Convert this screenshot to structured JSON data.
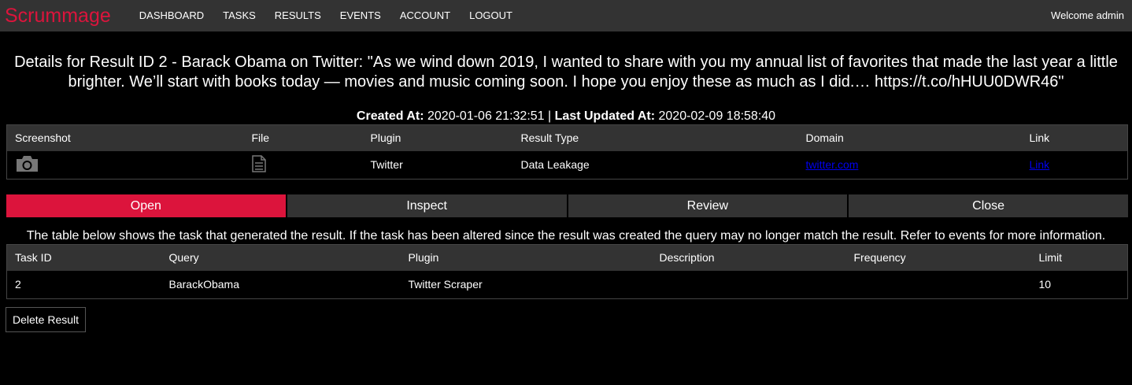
{
  "navbar": {
    "brand": "Scrummage",
    "items": [
      "DASHBOARD",
      "TASKS",
      "RESULTS",
      "EVENTS",
      "ACCOUNT",
      "LOGOUT"
    ],
    "welcome": "Welcome admin"
  },
  "title": "Details for Result ID 2 - Barack Obama on Twitter: \"As we wind down 2019, I wanted to share with you my annual list of favorites that made the last year a little brighter. We’ll start with books today — movies and music coming soon. I hope you enjoy these as much as I did.… https://t.co/hHUU0DWR46\"",
  "timestamps": {
    "created_label": "Created At:",
    "created_value": "2020-01-06 21:32:51",
    "separator": "|",
    "updated_label": "Last Updated At:",
    "updated_value": "2020-02-09 18:58:40"
  },
  "result_table": {
    "headers": [
      "Screenshot",
      "File",
      "Plugin",
      "Result Type",
      "Domain",
      "Link"
    ],
    "row": {
      "screenshot_icon": "camera-icon",
      "file_icon": "file-icon",
      "plugin": "Twitter",
      "result_type": "Data Leakage",
      "domain": "twitter.com",
      "link": "Link"
    }
  },
  "status_buttons": [
    "Open",
    "Inspect",
    "Review",
    "Close"
  ],
  "active_status": "Open",
  "accent_color": "#dc143c",
  "note": "The table below shows the task that generated the result. If the task has been altered since the result was created the query may no longer match the result. Refer to events for more information.",
  "task_table": {
    "headers": [
      "Task ID",
      "Query",
      "Plugin",
      "Description",
      "Frequency",
      "Limit"
    ],
    "row": {
      "task_id": "2",
      "query": "BarackObama",
      "plugin": "Twitter Scraper",
      "description": "",
      "frequency": "",
      "limit": "10"
    }
  },
  "delete_button": "Delete Result"
}
